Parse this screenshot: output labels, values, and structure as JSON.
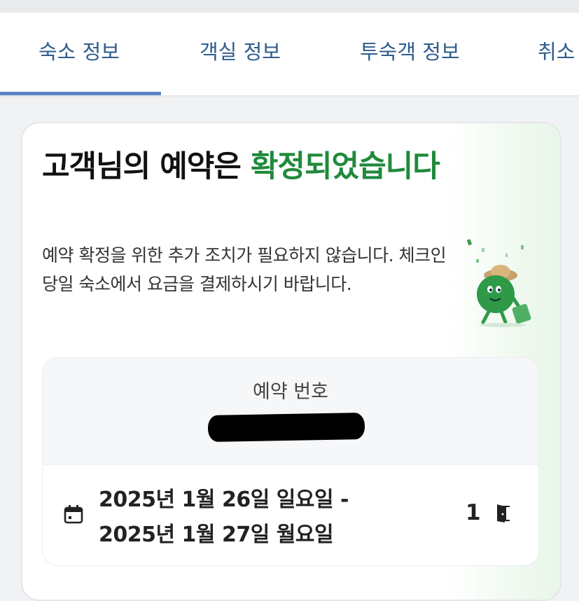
{
  "tabs": [
    {
      "label": "숙소 정보",
      "active": true
    },
    {
      "label": "객실 정보",
      "active": false
    },
    {
      "label": "투숙객 정보",
      "active": false
    },
    {
      "label": "취소",
      "active": false
    }
  ],
  "confirmation": {
    "title_prefix": "고객님의 예약은 ",
    "title_highlight": "확정되었습니다",
    "description": "예약 확정을 위한 추가 조치가 필요하지 않습니다. 체크인 당일 숙소에서 요금을 결제하시기 바랍니다."
  },
  "reservation": {
    "number_label": "예약 번호",
    "check_in": "2025년 1월 26일 일요일 -",
    "check_out": "2025년 1월 27일 월요일",
    "room_count": "1",
    "icons": [
      "calendar-icon",
      "door-icon"
    ]
  },
  "colors": {
    "accent_tab": "#2f5d8c",
    "tab_indicator": "#5c84c9",
    "confirmed_green": "#1f8a3b"
  }
}
